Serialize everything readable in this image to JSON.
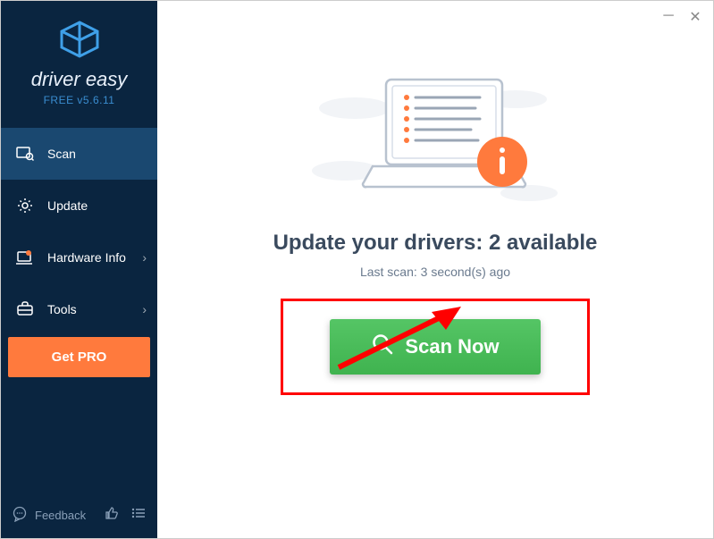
{
  "brand": {
    "name": "driver easy",
    "version": "FREE v5.6.11"
  },
  "sidebar": {
    "items": [
      {
        "label": "Scan"
      },
      {
        "label": "Update"
      },
      {
        "label": "Hardware Info"
      },
      {
        "label": "Tools"
      }
    ],
    "get_pro": "Get PRO",
    "feedback": "Feedback"
  },
  "main": {
    "heading": "Update your drivers: 2 available",
    "subheading": "Last scan: 3 second(s) ago",
    "scan_button": "Scan Now"
  },
  "colors": {
    "sidebar_bg": "#0a2540",
    "accent_orange": "#ff7a3d",
    "scan_green": "#4bbd5a",
    "highlight_red": "#ff0000"
  }
}
